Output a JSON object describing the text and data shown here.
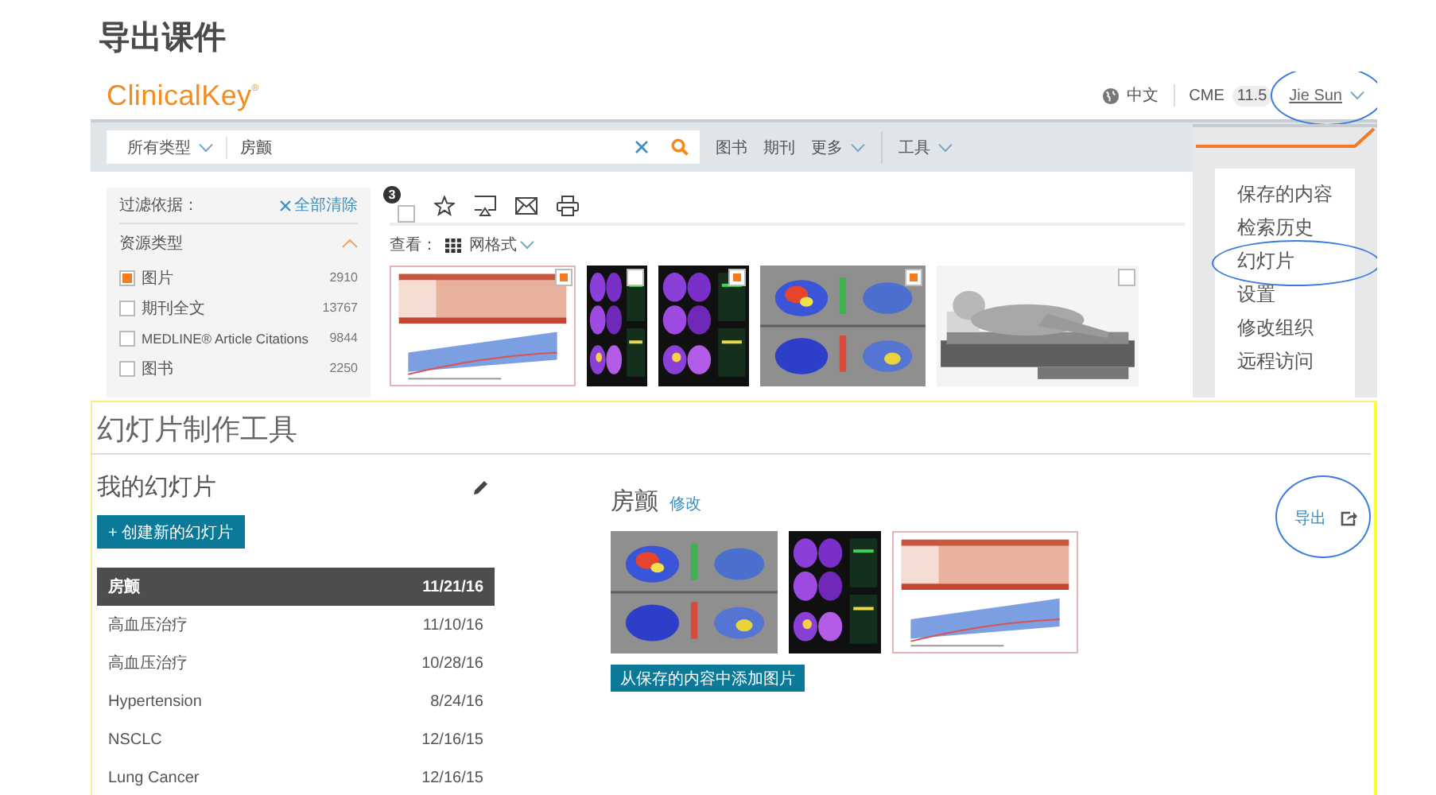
{
  "heading": "导出课件",
  "clinicalkey": {
    "logo": "ClinicalKey",
    "logo_mark": "®",
    "language": "中文",
    "cme_label": "CME",
    "cme_value": "11.5",
    "user": {
      "name": "Jie Sun",
      "annotated": true
    },
    "search": {
      "type": "所有类型",
      "query": "房颤"
    },
    "nav": [
      {
        "label": "图书",
        "dropdown": false
      },
      {
        "label": "期刊",
        "dropdown": false
      },
      {
        "label": "更多",
        "dropdown": true
      },
      {
        "label": "工具",
        "dropdown": true
      }
    ],
    "user_menu": [
      {
        "label": "保存的内容",
        "annotated": false
      },
      {
        "label": "检索历史",
        "annotated": false
      },
      {
        "label": "幻灯片",
        "annotated": true
      },
      {
        "label": "设置",
        "annotated": false
      },
      {
        "label": "修改组织",
        "annotated": false
      },
      {
        "label": "远程访问",
        "annotated": false
      }
    ],
    "filter": {
      "title": "过滤依据：",
      "clear": "全部清除",
      "section": "资源类型",
      "items": [
        {
          "label": "图片",
          "count": "2910",
          "checked": true
        },
        {
          "label": "期刊全文",
          "count": "13767",
          "checked": false
        },
        {
          "label": "MEDLINE® Article Citations",
          "count": "9844",
          "checked": false
        },
        {
          "label": "图书",
          "count": "2250",
          "checked": false
        }
      ]
    },
    "selected_count": "3",
    "select_all_checked": false,
    "view_label": "查看：",
    "view_mode": "网格式",
    "results": [
      {
        "kind": "picture",
        "checked": true
      },
      {
        "kind": "picture",
        "checked": false
      },
      {
        "kind": "picture",
        "checked": true
      },
      {
        "kind": "picture",
        "checked": true
      },
      {
        "kind": "picture",
        "checked": false
      }
    ]
  },
  "slide_maker": {
    "title": "幻灯片制作工具",
    "my_slides": "我的幻灯片",
    "create_button": "+ 创建新的幻灯片",
    "slides": [
      {
        "name": "房颤",
        "date": "11/21/16",
        "selected": true
      },
      {
        "name": "高血压治疗",
        "date": "11/10/16",
        "selected": false
      },
      {
        "name": "高血压治疗",
        "date": "10/28/16",
        "selected": false
      },
      {
        "name": "Hypertension",
        "date": "8/24/16",
        "selected": false
      },
      {
        "name": "NSCLC",
        "date": "12/16/15",
        "selected": false
      },
      {
        "name": "Lung Cancer",
        "date": "12/16/15",
        "selected": false
      }
    ],
    "current": {
      "title": "房颤",
      "edit": "修改",
      "images": [
        {
          "kind": "picture"
        },
        {
          "kind": "picture"
        },
        {
          "kind": "picture"
        }
      ],
      "add_button": "从保存的内容中添加图片"
    },
    "export": {
      "label": "导出",
      "annotated": true
    }
  }
}
